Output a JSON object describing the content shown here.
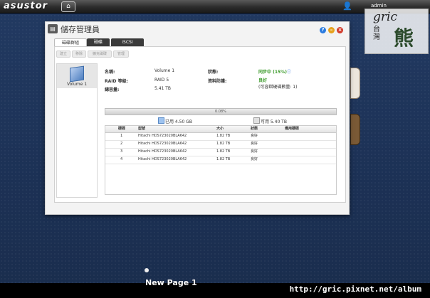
{
  "topbar": {
    "logo": "asustor",
    "home_icon": "home-icon",
    "user_icon": "user-icon",
    "user_name": "admin"
  },
  "watermark": {
    "word": "gric",
    "tw": "台灣",
    "bear": "熊"
  },
  "window": {
    "title": "儲存管理員",
    "tabs": [
      "磁碟群組",
      "磁碟",
      "iSCSI"
    ],
    "toolbar": [
      "建立",
      "移除",
      "擴充磁碟",
      "管理"
    ],
    "volume": {
      "label": "Volume 1"
    },
    "info": {
      "name_key": "名稱:",
      "name_val": "Volume 1",
      "raid_key": "RAID 等級:",
      "raid_val": "RAID 5",
      "capacity_key": "總容量:",
      "capacity_val": "5.41 TB",
      "status_key": "狀態:",
      "status_val": "同步中 (15%)",
      "health_key": "資料防護:",
      "health_val": "良好",
      "health_note": "(可容錯硬碟數量: 1)"
    },
    "usage": {
      "percent_label": "0.08%",
      "used_label": "已用 4.50 GB",
      "free_label": "可用 5.40 TB"
    },
    "disk_table": {
      "headers": [
        "硬碟",
        "型號",
        "大小",
        "狀態",
        "備用硬碟"
      ],
      "rows": [
        [
          "1",
          "Hitachi HDS723020BLA642",
          "1.82 TB",
          "良好",
          ""
        ],
        [
          "2",
          "Hitachi HDS723020BLA642",
          "1.82 TB",
          "良好",
          ""
        ],
        [
          "3",
          "Hitachi HDS723020BLA642",
          "1.82 TB",
          "良好",
          ""
        ],
        [
          "4",
          "Hitachi HDS723020BLA642",
          "1.82 TB",
          "良好",
          ""
        ]
      ]
    }
  },
  "bottom": {
    "page_title": "New Page 1",
    "url": "http://gric.pixnet.net/album"
  }
}
